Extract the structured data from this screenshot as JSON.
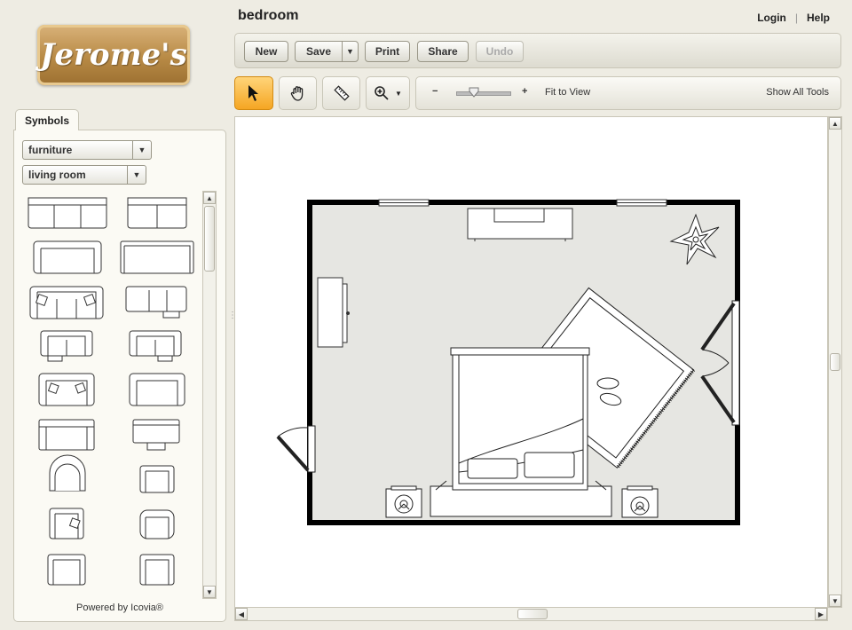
{
  "app": {
    "title": "bedroom",
    "logo_text": "Jerome's"
  },
  "header_links": {
    "login": "Login",
    "separator": "|",
    "help": "Help"
  },
  "toolbar": {
    "new": "New",
    "save": "Save",
    "print": "Print",
    "share": "Share",
    "undo": "Undo"
  },
  "view_controls": {
    "zoom_out": "−",
    "zoom_in": "+",
    "fit_to_view": "Fit to View",
    "show_all_tools": "Show All Tools",
    "zoom_level": 0.35
  },
  "sidebar": {
    "tab": "Symbols",
    "category": "furniture",
    "subcategory": "living room",
    "footer": "Powered by Icovia®"
  },
  "tools": [
    "select-icon",
    "pan-hand-icon",
    "measure-ruler-icon",
    "zoom-icon"
  ],
  "colors": {
    "accent": "#f5a623",
    "room_floor": "#e6e6e2",
    "wall": "#000000",
    "brand": "#b88a45"
  }
}
